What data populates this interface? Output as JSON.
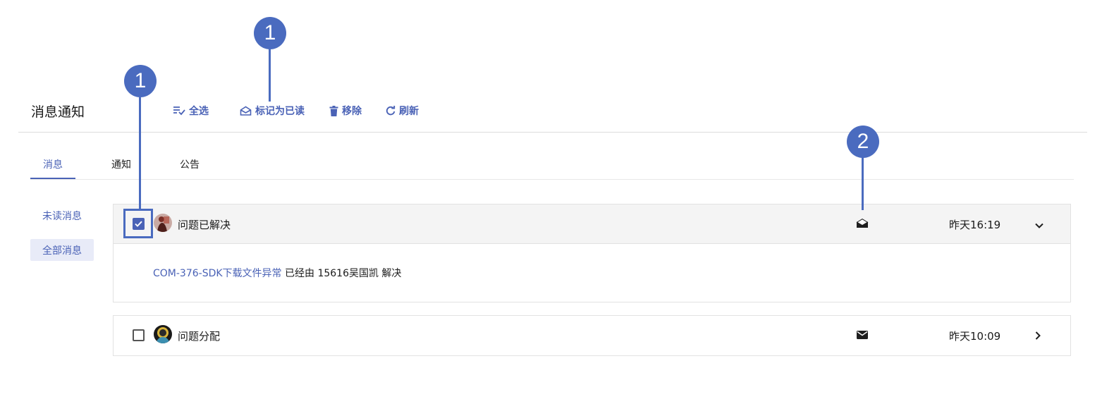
{
  "header": {
    "title": "消息通知",
    "toolbar": {
      "select_all": "全选",
      "mark_read": "标记为已读",
      "remove": "移除",
      "refresh": "刷新"
    }
  },
  "tabs": [
    {
      "label": "消息",
      "active": true
    },
    {
      "label": "通知",
      "active": false
    },
    {
      "label": "公告",
      "active": false
    }
  ],
  "sidebar": {
    "items": [
      {
        "label": "未读消息",
        "active": false
      },
      {
        "label": "全部消息",
        "active": true
      }
    ]
  },
  "messages": [
    {
      "title": "问题已解决",
      "checked": true,
      "read_icon": "envelope-open-icon",
      "time": "昨天16:19",
      "expanded": true,
      "body": {
        "link": "COM-376-SDK下载文件异常",
        "text": " 已经由 15616吴国凯 解决"
      }
    },
    {
      "title": "问题分配",
      "checked": false,
      "read_icon": "envelope-closed-icon",
      "time": "昨天10:09",
      "expanded": false
    }
  ],
  "annotations": {
    "callout_checkbox": "1",
    "callout_mark_read": "1",
    "callout_envelope": "2"
  },
  "colors": {
    "accent": "#4a62b6",
    "annotation": "#4a6bbf",
    "selected_bg": "#e8ebf8"
  }
}
